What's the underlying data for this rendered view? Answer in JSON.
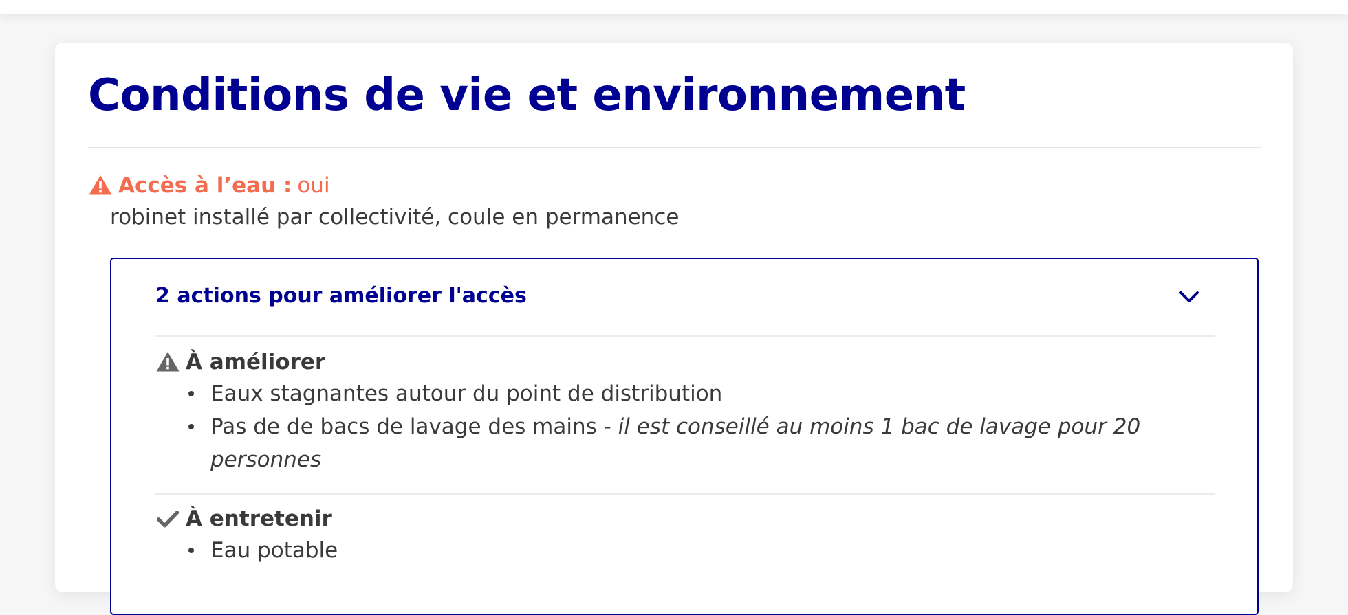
{
  "section": {
    "title": "Conditions de vie et environnement"
  },
  "water_access": {
    "label": "Accès à l’eau :",
    "value": "oui",
    "detail": "robinet installé par collectivité, coule en permanence",
    "status_color": "#f26c4f",
    "icon": "warning-icon"
  },
  "accordion": {
    "title": "2 actions pour améliorer l'accès",
    "expanded": true,
    "icon": "chevron-down-icon",
    "groups": [
      {
        "heading": "À améliorer",
        "icon": "warning-icon",
        "items": [
          {
            "text": "Eaux stagnantes autour du point de distribution",
            "note": ""
          },
          {
            "text": "Pas de de bacs de lavage des mains - ",
            "note": "il est conseillé au moins 1 bac de lavage pour 20 personnes"
          }
        ]
      },
      {
        "heading": "À entretenir",
        "icon": "check-icon",
        "items": [
          {
            "text": "Eau potable",
            "note": ""
          }
        ]
      }
    ]
  },
  "colors": {
    "primary": "#000091",
    "warning": "#f26c4f",
    "text": "#3a3a3a"
  }
}
